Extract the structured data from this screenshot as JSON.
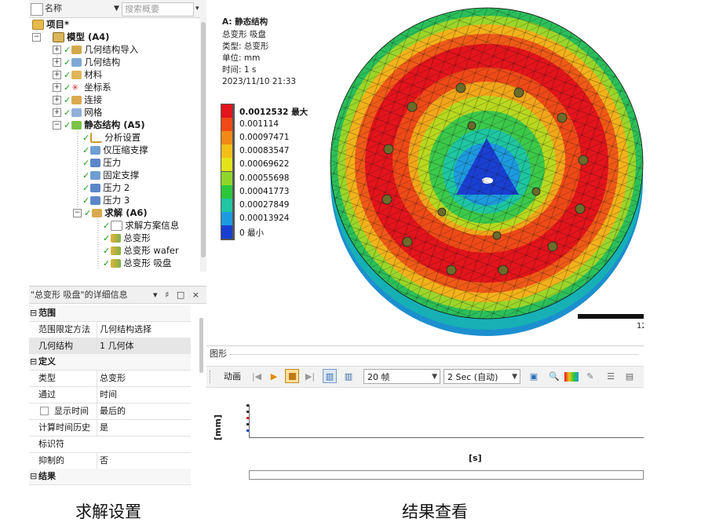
{
  "tree": {
    "header_name": "名称",
    "search_placeholder": "搜索概要",
    "items": [
      {
        "label": "项目*",
        "bold": true
      },
      {
        "label": "模型 (A4)",
        "bold": true
      },
      {
        "label": "几何结构导入"
      },
      {
        "label": "几何结构"
      },
      {
        "label": "材料"
      },
      {
        "label": "坐标系"
      },
      {
        "label": "连接"
      },
      {
        "label": "网格"
      },
      {
        "label": "静态结构 (A5)",
        "bold": true
      },
      {
        "label": "分析设置"
      },
      {
        "label": "仅压缩支撑"
      },
      {
        "label": "压力"
      },
      {
        "label": "固定支撑"
      },
      {
        "label": "压力 2"
      },
      {
        "label": "压力 3"
      },
      {
        "label": "求解 (A6)",
        "bold": true
      },
      {
        "label": "求解方案信息"
      },
      {
        "label": "总变形"
      },
      {
        "label": "总变形 wafer"
      },
      {
        "label": "总变形 吸盘"
      }
    ]
  },
  "details": {
    "title": "\"总变形 吸盘\"的详细信息",
    "title_controls": "▾ ♯ □ ×",
    "sections": {
      "scope": "范围",
      "definition": "定义",
      "results": "结果"
    },
    "rows": [
      {
        "key": "范围限定方法",
        "value": "几何结构选择"
      },
      {
        "key": "几何结构",
        "value": "1 几何体"
      },
      {
        "key": "类型",
        "value": "总变形"
      },
      {
        "key": "通过",
        "value": "时间"
      },
      {
        "key": "显示时间",
        "value": "最后的"
      },
      {
        "key": "计算时间历史",
        "value": "是"
      },
      {
        "key": "标识符",
        "value": ""
      },
      {
        "key": "抑制的",
        "value": "否"
      }
    ]
  },
  "viewport": {
    "title": "A: 静态结构",
    "subtitle": "总变形 吸盘",
    "type_line": "类型: 总变形",
    "unit_line": "单位: mm",
    "time_line": "时间: 1 s",
    "date_line": "2023/11/10 21:33",
    "scale_tick": "12",
    "legend": [
      {
        "label": "0.0012532 最大",
        "color": "#e3141b"
      },
      {
        "label": "0.001114",
        "color": "#ef4a17"
      },
      {
        "label": "0.00097471",
        "color": "#f28a18"
      },
      {
        "label": "0.00083547",
        "color": "#f2c019"
      },
      {
        "label": "0.00069622",
        "color": "#e3e31a"
      },
      {
        "label": "0.00055698",
        "color": "#8fd62a"
      },
      {
        "label": "0.00041773",
        "color": "#2bc83e"
      },
      {
        "label": "0.00027849",
        "color": "#1ec6a1"
      },
      {
        "label": "0.00013924",
        "color": "#1d9bdf"
      },
      {
        "label": "0 最小",
        "color": "#1a3fd2"
      }
    ]
  },
  "graph": {
    "title": "图形",
    "animate_label": "动画",
    "frames_value": "20 帧",
    "duration_value": "2 Sec (自动)",
    "y_axis_label": "[mm]",
    "x_axis_label": "[s]"
  },
  "captions": {
    "left": "求解设置",
    "right": "结果查看"
  }
}
